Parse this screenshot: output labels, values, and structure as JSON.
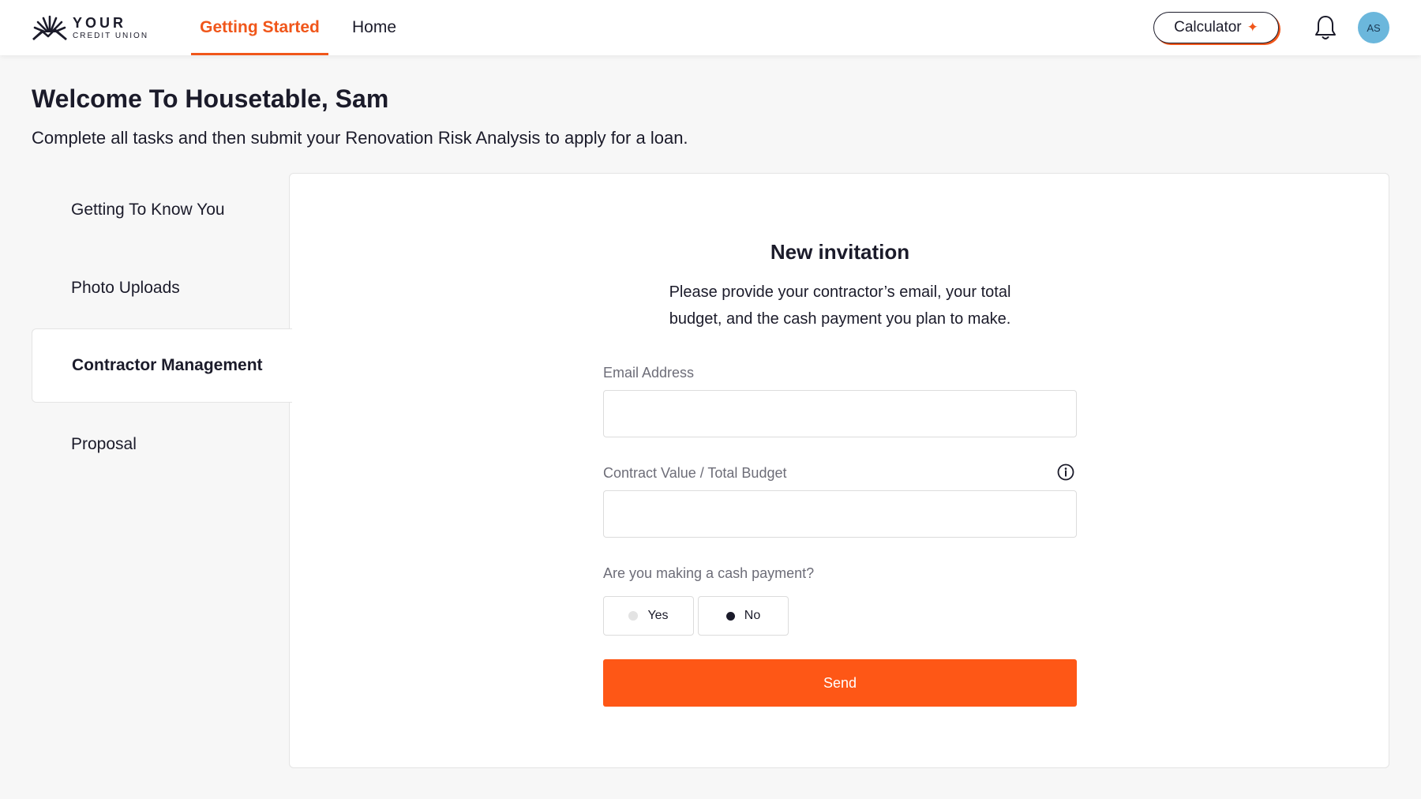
{
  "brand": {
    "logo_line1": "YOUR",
    "logo_line2": "CREDIT UNION",
    "logo_icon": "sunburst-logo-icon",
    "accent_color": "#f0561a",
    "send_color": "#fe5716"
  },
  "nav": {
    "tabs": [
      {
        "label": "Getting Started",
        "active": true
      },
      {
        "label": "Home",
        "active": false
      }
    ],
    "calculator_label": "Calculator",
    "calculator_icon": "sparkle-icon",
    "spark_glyph": "✦",
    "bell_icon": "bell-icon",
    "avatar_initials": "AS",
    "avatar_color": "#6bb7dc"
  },
  "welcome": {
    "title": "Welcome To Housetable, Sam",
    "subtitle": "Complete all tasks and then submit your Renovation Risk Analysis to apply for a loan."
  },
  "sidebar": {
    "items": [
      {
        "label": "Getting To Know You",
        "active": false
      },
      {
        "label": "Photo Uploads",
        "active": false
      },
      {
        "label": "Contractor Management",
        "active": true
      },
      {
        "label": "Proposal",
        "active": false
      }
    ]
  },
  "form": {
    "title": "New invitation",
    "description": "Please provide your contractor’s email, your total budget, and the cash payment you plan to make.",
    "email_label": "Email Address",
    "email_value": "",
    "email_placeholder": "",
    "budget_label": "Contract Value / Total Budget",
    "budget_info_icon": "info-icon",
    "budget_value": "",
    "budget_placeholder": "",
    "cash_question": "Are you making a cash payment?",
    "cash_options": [
      {
        "label": "Yes",
        "selected": false
      },
      {
        "label": "No",
        "selected": true
      }
    ],
    "send_label": "Send"
  }
}
